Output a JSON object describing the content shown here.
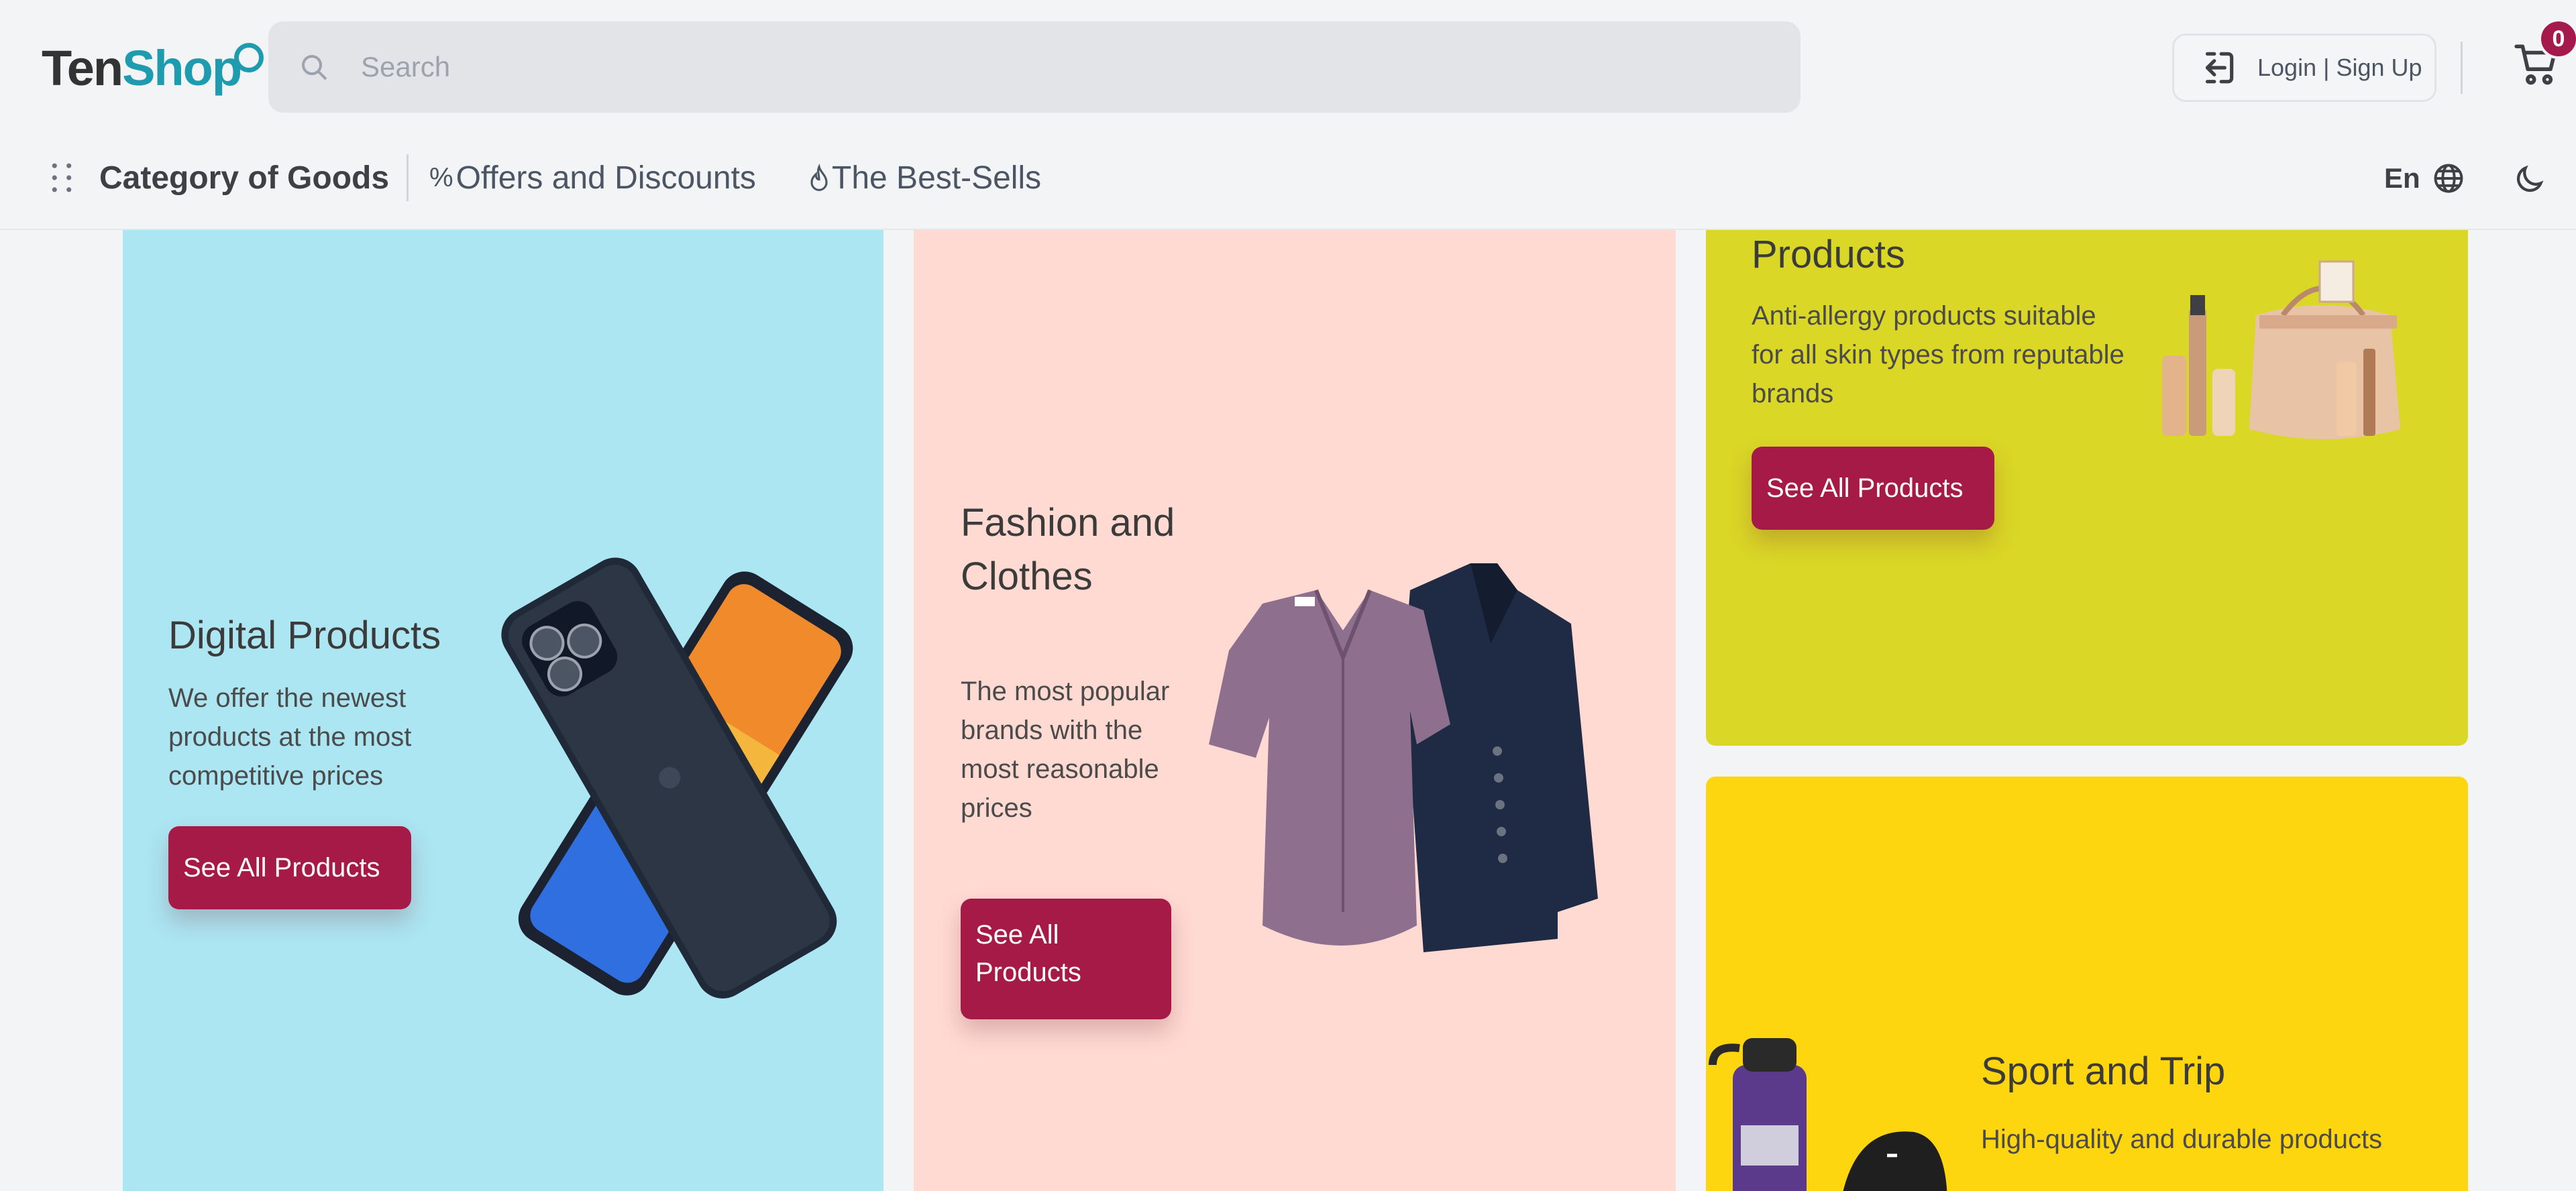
{
  "brand": {
    "name_part1": "Ten",
    "name_part2": "Shop"
  },
  "search": {
    "placeholder": "Search"
  },
  "auth": {
    "login_label": "Login | Sign Up"
  },
  "cart": {
    "count": "0"
  },
  "nav": {
    "category_label": "Category of Goods",
    "offers_glyph": "%",
    "offers_label": "Offers and Discounts",
    "bestsells_label": "The Best-Sells",
    "language": "En"
  },
  "cards": {
    "digital": {
      "title": "Digital Products",
      "description": "We offer the newest products at the most competitive prices",
      "cta": "See All Products"
    },
    "fashion": {
      "title": "Fashion and Clothes",
      "description": "The most popular brands with the most reasonable prices",
      "cta": "See All Products"
    },
    "beauty": {
      "title": "Products",
      "description": "Anti-allergy products suitable for all skin types from reputable brands",
      "cta": "See All Products"
    },
    "sport": {
      "title": "Sport and Trip",
      "description": "High-quality and durable products"
    }
  },
  "colors": {
    "accent": "#a61a48",
    "brand_teal": "#1f9bb0",
    "card_digital": "#ace6f2",
    "card_fashion": "#ffdad3",
    "card_beauty": "#dad726",
    "card_sport": "#fed60f"
  }
}
